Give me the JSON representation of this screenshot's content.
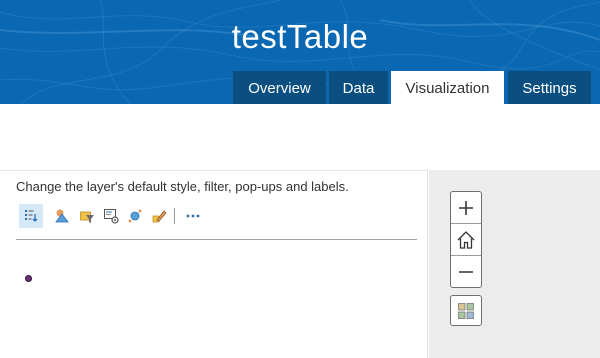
{
  "header": {
    "title": "testTable",
    "background_color": "#0a67b1",
    "tab_color": "#0b4f80",
    "tabs": [
      {
        "label": "Overview",
        "active": false
      },
      {
        "label": "Data",
        "active": false
      },
      {
        "label": "Visualization",
        "active": true
      },
      {
        "label": "Settings",
        "active": false
      }
    ]
  },
  "panel": {
    "description": "Change the layer's default style, filter, pop-ups and labels.",
    "toolbar": {
      "tools": [
        {
          "icon": "change-style-icon",
          "active": true
        },
        {
          "icon": "shapes-style-icon",
          "active": false
        },
        {
          "icon": "filter-icon",
          "active": false
        },
        {
          "icon": "configure-popup-icon",
          "active": false
        },
        {
          "icon": "labels-icon",
          "active": false
        },
        {
          "icon": "edit-icon",
          "active": false
        }
      ],
      "more_icon": "more-options-icon"
    },
    "symbol_color": "#6a2f7c"
  },
  "map": {
    "background": "#ececec",
    "controls": [
      "zoom-in-icon",
      "home-icon",
      "zoom-out-icon",
      "basemap-gallery-icon"
    ]
  }
}
